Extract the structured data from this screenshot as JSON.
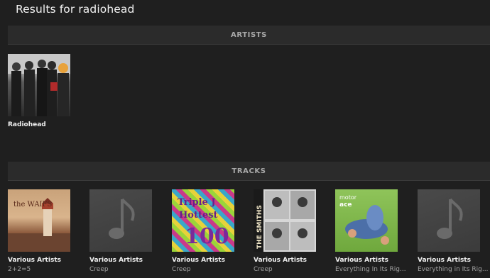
{
  "page": {
    "title": "Results for radiohead"
  },
  "sections": {
    "artists": {
      "label": "ARTISTS"
    },
    "tracks": {
      "label": "TRACKS"
    }
  },
  "artists": [
    {
      "name": "Radiohead",
      "art": "band-photo"
    }
  ],
  "tracks": [
    {
      "artist": "Various Artists",
      "title": "2+2=5",
      "art": "the-waifs-lighthouse"
    },
    {
      "artist": "Various Artists",
      "title": "Creep",
      "art": "music-note-placeholder"
    },
    {
      "artist": "Various Artists",
      "title": "Creep",
      "art": "triple-j-hottest-100"
    },
    {
      "artist": "Various Artists",
      "title": "Creep",
      "art": "the-smiths-cover"
    },
    {
      "artist": "Various Artists",
      "title": "Everything In Its Rig...",
      "art": "motor-ace-cover"
    },
    {
      "artist": "Various Artists",
      "title": "Everything in Its Rig...",
      "art": "music-note-placeholder"
    }
  ],
  "artwork_text": {
    "waifs": "the WAIFS",
    "jjj_top": "Triple J",
    "jjj_mid": "Hottest",
    "jjj_num": "100",
    "smiths": "THE SMITHS",
    "motorace_1": "motor",
    "motorace_2": "ace"
  }
}
